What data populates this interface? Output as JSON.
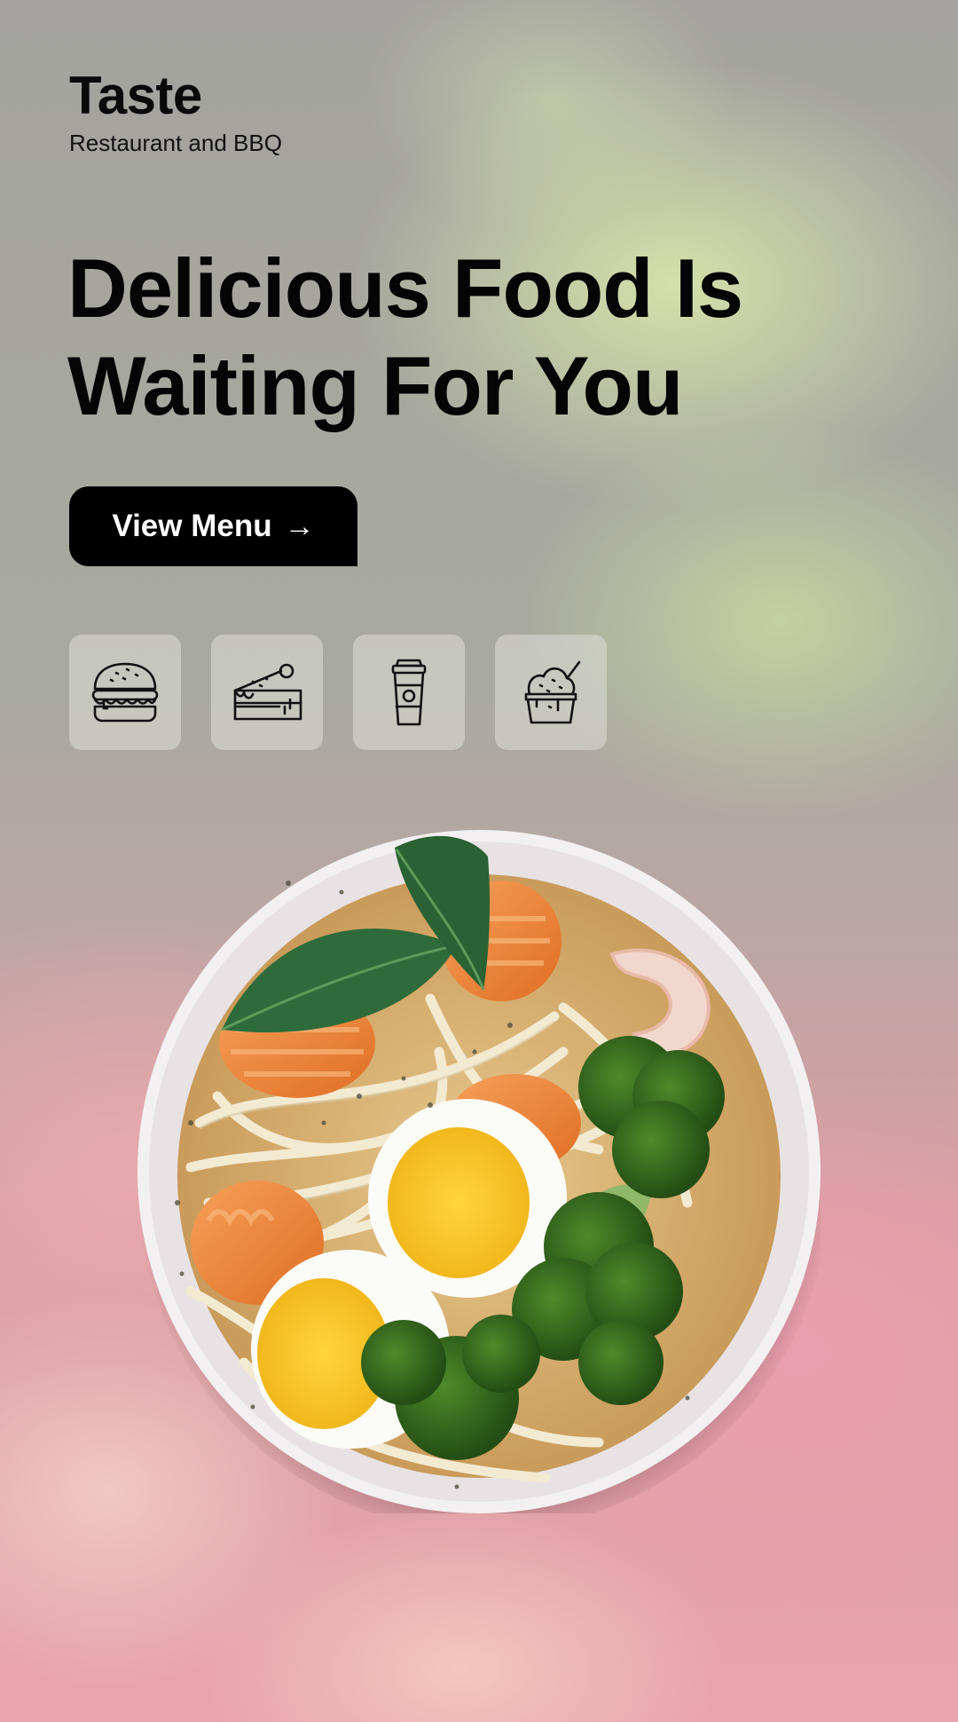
{
  "brand": {
    "title": "Taste",
    "subtitle": "Restaurant and BBQ"
  },
  "hero": {
    "headline_line1": "Delicious Food Is",
    "headline_line2": "Waiting For You",
    "cta_label": "View Menu",
    "cta_icon": "arrow-right-icon",
    "cta_arrow": "→"
  },
  "categories": [
    {
      "icon": "burger-icon"
    },
    {
      "icon": "cake-slice-icon"
    },
    {
      "icon": "coffee-cup-icon"
    },
    {
      "icon": "ice-cream-icon"
    }
  ],
  "hero_image": {
    "subject": "noodle-bowl-with-egg-and-broccoli"
  },
  "colors": {
    "text": "#050505",
    "button_bg": "#000000",
    "button_text": "#ffffff",
    "category_tile": "#dcdcd6"
  }
}
